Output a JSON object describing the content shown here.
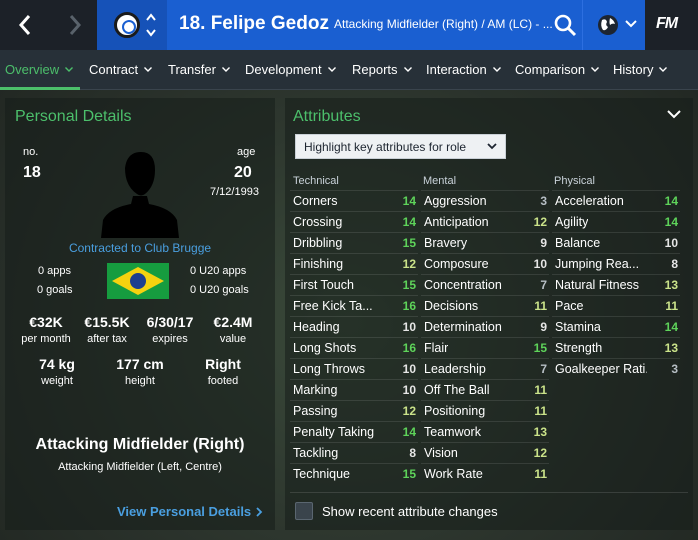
{
  "header": {
    "squad_number": "18.",
    "player_name": "Felipe Gedoz",
    "position_short": "Attacking Midfielder (Right) / AM (LC) - ...",
    "logo": "FM"
  },
  "tabs": [
    {
      "label": "Overview",
      "active": true
    },
    {
      "label": "Contract",
      "active": false
    },
    {
      "label": "Transfer",
      "active": false
    },
    {
      "label": "Development",
      "active": false
    },
    {
      "label": "Reports",
      "active": false
    },
    {
      "label": "Interaction",
      "active": false
    },
    {
      "label": "Comparison",
      "active": false
    },
    {
      "label": "History",
      "active": false
    }
  ],
  "personal": {
    "title": "Personal Details",
    "no_label": "no.",
    "no_value": "18",
    "age_label": "age",
    "age_value": "20",
    "dob": "7/12/1993",
    "contract": "Contracted to Club Brugge",
    "apps": "0 apps",
    "goals": "0 goals",
    "u20_apps": "0 U20 apps",
    "u20_goals": "0 U20 goals",
    "finance": [
      {
        "value": "€32K",
        "label": "per month"
      },
      {
        "value": "€15.5K",
        "label": "after tax"
      },
      {
        "value": "6/30/17",
        "label": "expires"
      },
      {
        "value": "€2.4M",
        "label": "value"
      }
    ],
    "physical": [
      {
        "value": "74 kg",
        "label": "weight"
      },
      {
        "value": "177 cm",
        "label": "height"
      },
      {
        "value": "Right",
        "label": "footed"
      }
    ],
    "role_main": "Attacking Midfielder (Right)",
    "role_sub": "Attacking Midfielder (Left, Centre)",
    "view_link": "View Personal Details"
  },
  "attributes": {
    "title": "Attributes",
    "highlight_label": "Highlight key attributes for role",
    "recent_label": "Show recent attribute changes",
    "columns": [
      {
        "heading": "Technical",
        "rows": [
          {
            "name": "Corners",
            "value": "14"
          },
          {
            "name": "Crossing",
            "value": "14"
          },
          {
            "name": "Dribbling",
            "value": "15"
          },
          {
            "name": "Finishing",
            "value": "12"
          },
          {
            "name": "First Touch",
            "value": "15"
          },
          {
            "name": "Free Kick Ta...",
            "value": "16"
          },
          {
            "name": "Heading",
            "value": "10"
          },
          {
            "name": "Long Shots",
            "value": "16"
          },
          {
            "name": "Long Throws",
            "value": "10"
          },
          {
            "name": "Marking",
            "value": "10"
          },
          {
            "name": "Passing",
            "value": "12"
          },
          {
            "name": "Penalty Taking",
            "value": "14"
          },
          {
            "name": "Tackling",
            "value": "8"
          },
          {
            "name": "Technique",
            "value": "15"
          }
        ]
      },
      {
        "heading": "Mental",
        "rows": [
          {
            "name": "Aggression",
            "value": "3"
          },
          {
            "name": "Anticipation",
            "value": "12"
          },
          {
            "name": "Bravery",
            "value": "9"
          },
          {
            "name": "Composure",
            "value": "10"
          },
          {
            "name": "Concentration",
            "value": "7"
          },
          {
            "name": "Decisions",
            "value": "11"
          },
          {
            "name": "Determination",
            "value": "9"
          },
          {
            "name": "Flair",
            "value": "15"
          },
          {
            "name": "Leadership",
            "value": "7"
          },
          {
            "name": "Off The Ball",
            "value": "11"
          },
          {
            "name": "Positioning",
            "value": "11"
          },
          {
            "name": "Teamwork",
            "value": "13"
          },
          {
            "name": "Vision",
            "value": "12"
          },
          {
            "name": "Work Rate",
            "value": "11"
          }
        ]
      },
      {
        "heading": "Physical",
        "rows": [
          {
            "name": "Acceleration",
            "value": "14"
          },
          {
            "name": "Agility",
            "value": "14"
          },
          {
            "name": "Balance",
            "value": "10"
          },
          {
            "name": "Jumping Rea...",
            "value": "8"
          },
          {
            "name": "Natural Fitness",
            "value": "13"
          },
          {
            "name": "Pace",
            "value": "11"
          },
          {
            "name": "Stamina",
            "value": "14"
          },
          {
            "name": "Strength",
            "value": "13"
          },
          {
            "name": "Goalkeeper Rati...",
            "value": "3"
          }
        ]
      }
    ]
  },
  "colors": {
    "accent_green": "#4cbf6b",
    "header_blue": "#1a5fd1",
    "link_blue": "#4a9fe0"
  },
  "icons": [
    "back-arrow-icon",
    "forward-arrow-icon",
    "club-crest-icon",
    "search-icon",
    "globe-icon",
    "chevron-down-icon",
    "chevron-right-icon"
  ]
}
